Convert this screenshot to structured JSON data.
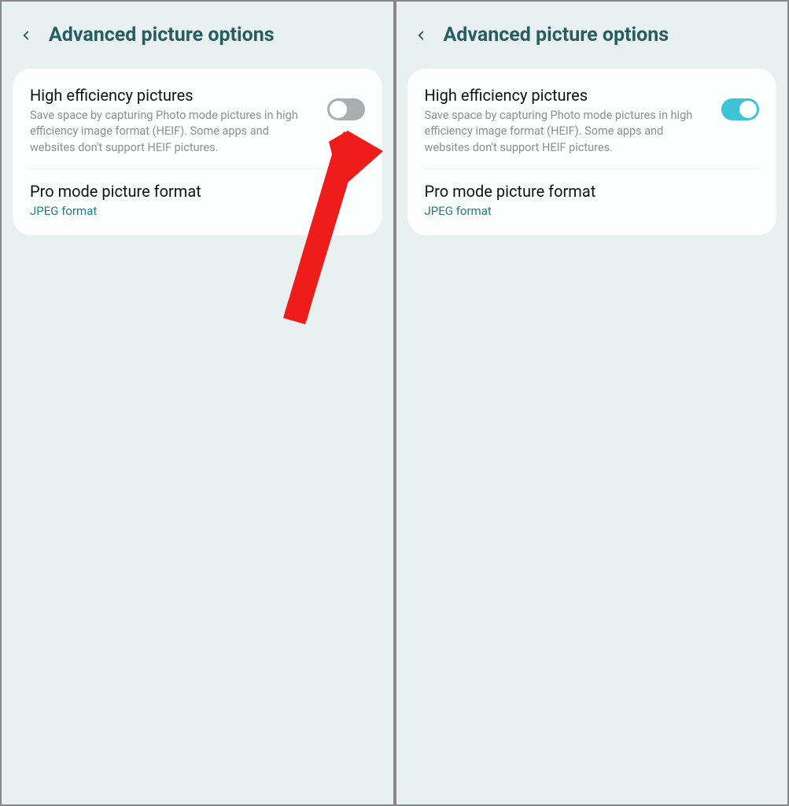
{
  "screens": [
    {
      "title": "Advanced picture options",
      "settings": {
        "heif": {
          "title": "High efficiency pictures",
          "desc": "Save space by capturing Photo mode pictures in high efficiency image format (HEIF). Some apps and websites don't support HEIF pictures.",
          "toggle_on": false
        },
        "pro": {
          "title": "Pro mode picture format",
          "value": "JPEG format"
        }
      },
      "show_arrow": true
    },
    {
      "title": "Advanced picture options",
      "settings": {
        "heif": {
          "title": "High efficiency pictures",
          "desc": "Save space by capturing Photo mode pictures in high efficiency image format (HEIF). Some apps and websites don't support HEIF pictures.",
          "toggle_on": true
        },
        "pro": {
          "title": "Pro mode picture format",
          "value": "JPEG format"
        }
      },
      "show_arrow": false
    }
  ]
}
